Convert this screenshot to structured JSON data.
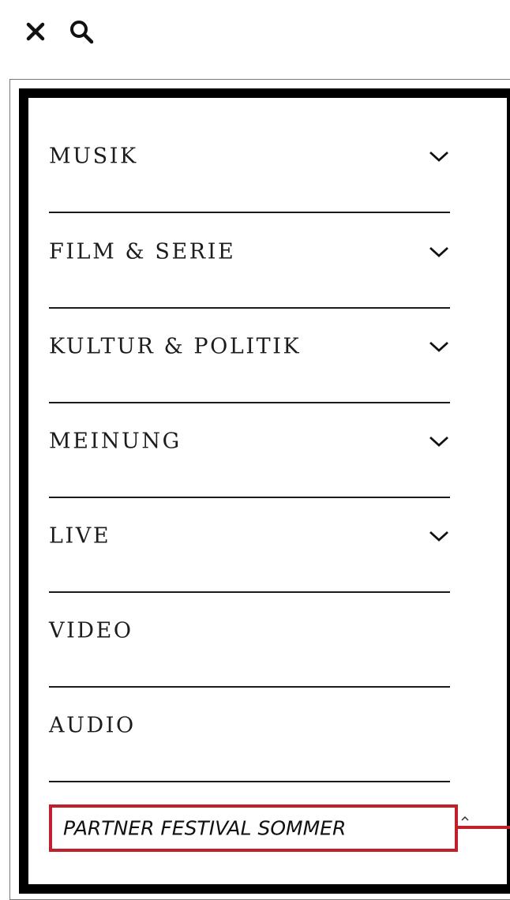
{
  "topbar": {
    "close_icon": "close-icon",
    "search_icon": "search-icon"
  },
  "menu": {
    "items": [
      {
        "label": "MUSIK",
        "has_submenu": true
      },
      {
        "label": "FILM & SERIE",
        "has_submenu": true
      },
      {
        "label": "KULTUR & POLITIK",
        "has_submenu": true
      },
      {
        "label": "MEINUNG",
        "has_submenu": true
      },
      {
        "label": "LIVE",
        "has_submenu": true
      },
      {
        "label": "VIDEO",
        "has_submenu": false
      },
      {
        "label": "AUDIO",
        "has_submenu": false
      }
    ],
    "partner": {
      "label": "PARTNER FESTIVAL SOMMER",
      "has_submenu": true
    }
  },
  "colors": {
    "text": "#1c1c1c",
    "panel_border": "#000000",
    "highlight": "#c0202a"
  }
}
